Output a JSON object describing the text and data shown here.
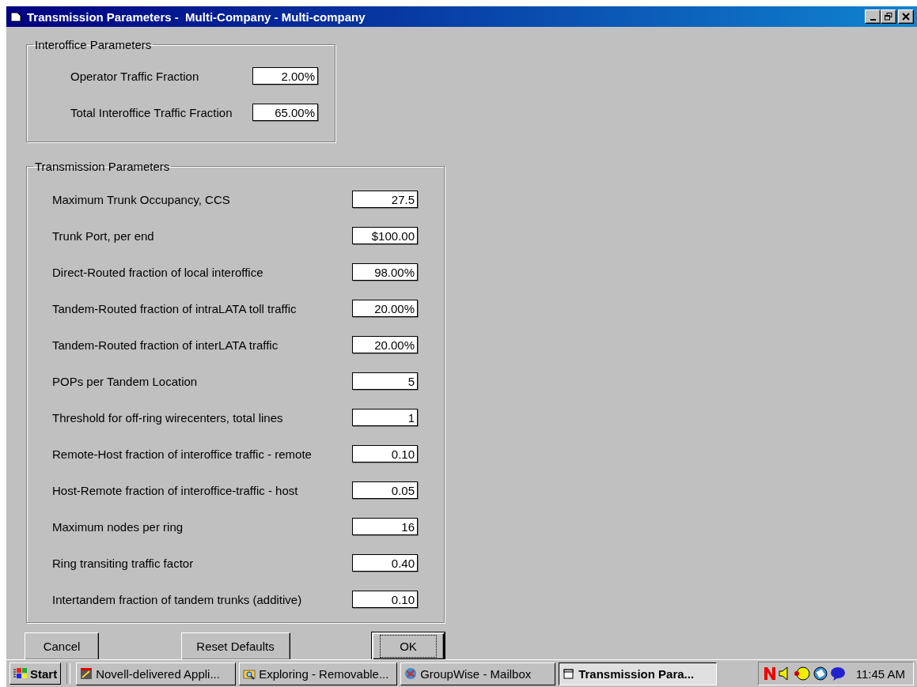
{
  "window": {
    "title": "Transmission Parameters -  Multi-Company - Multi-company"
  },
  "interoffice": {
    "title": "Interoffice Parameters",
    "fields": [
      {
        "label": "Operator Traffic Fraction",
        "value": "2.00%"
      },
      {
        "label": "Total Interoffice Traffic Fraction",
        "value": "65.00%"
      }
    ]
  },
  "transmission": {
    "title": "Transmission Parameters",
    "fields": [
      {
        "label": "Maximum Trunk Occupancy, CCS",
        "value": "27.5"
      },
      {
        "label": "Trunk Port, per end",
        "value": "$100.00"
      },
      {
        "label": "Direct-Routed fraction of local interoffice",
        "value": "98.00%"
      },
      {
        "label": "Tandem-Routed fraction of intraLATA toll traffic",
        "value": "20.00%"
      },
      {
        "label": "Tandem-Routed fraction of interLATA traffic",
        "value": "20.00%"
      },
      {
        "label": "POPs per Tandem Location",
        "value": "5"
      },
      {
        "label": "Threshold for off-ring wirecenters, total lines",
        "value": "1"
      },
      {
        "label": "Remote-Host fraction of interoffice traffic - remote",
        "value": "0.10"
      },
      {
        "label": "Host-Remote fraction of interoffice-traffic - host",
        "value": "0.05"
      },
      {
        "label": "Maximum nodes per ring",
        "value": "16"
      },
      {
        "label": "Ring transiting traffic factor",
        "value": "0.40"
      },
      {
        "label": "Intertandem fraction of tandem trunks (additive)",
        "value": "0.10"
      }
    ]
  },
  "buttons": [
    {
      "label": "Cancel",
      "default": false
    },
    {
      "label": "Reset Defaults",
      "default": false
    },
    {
      "label": "OK",
      "default": true
    }
  ],
  "taskbar": {
    "start": "Start",
    "tasks": [
      {
        "label": "Novell-delivered Appli...",
        "selected": false
      },
      {
        "label": "Exploring - Removable...",
        "selected": false
      },
      {
        "label": "GroupWise - Mailbox",
        "selected": false
      },
      {
        "label": "Transmission Para...",
        "selected": true
      }
    ],
    "clock": "11:45 AM"
  }
}
